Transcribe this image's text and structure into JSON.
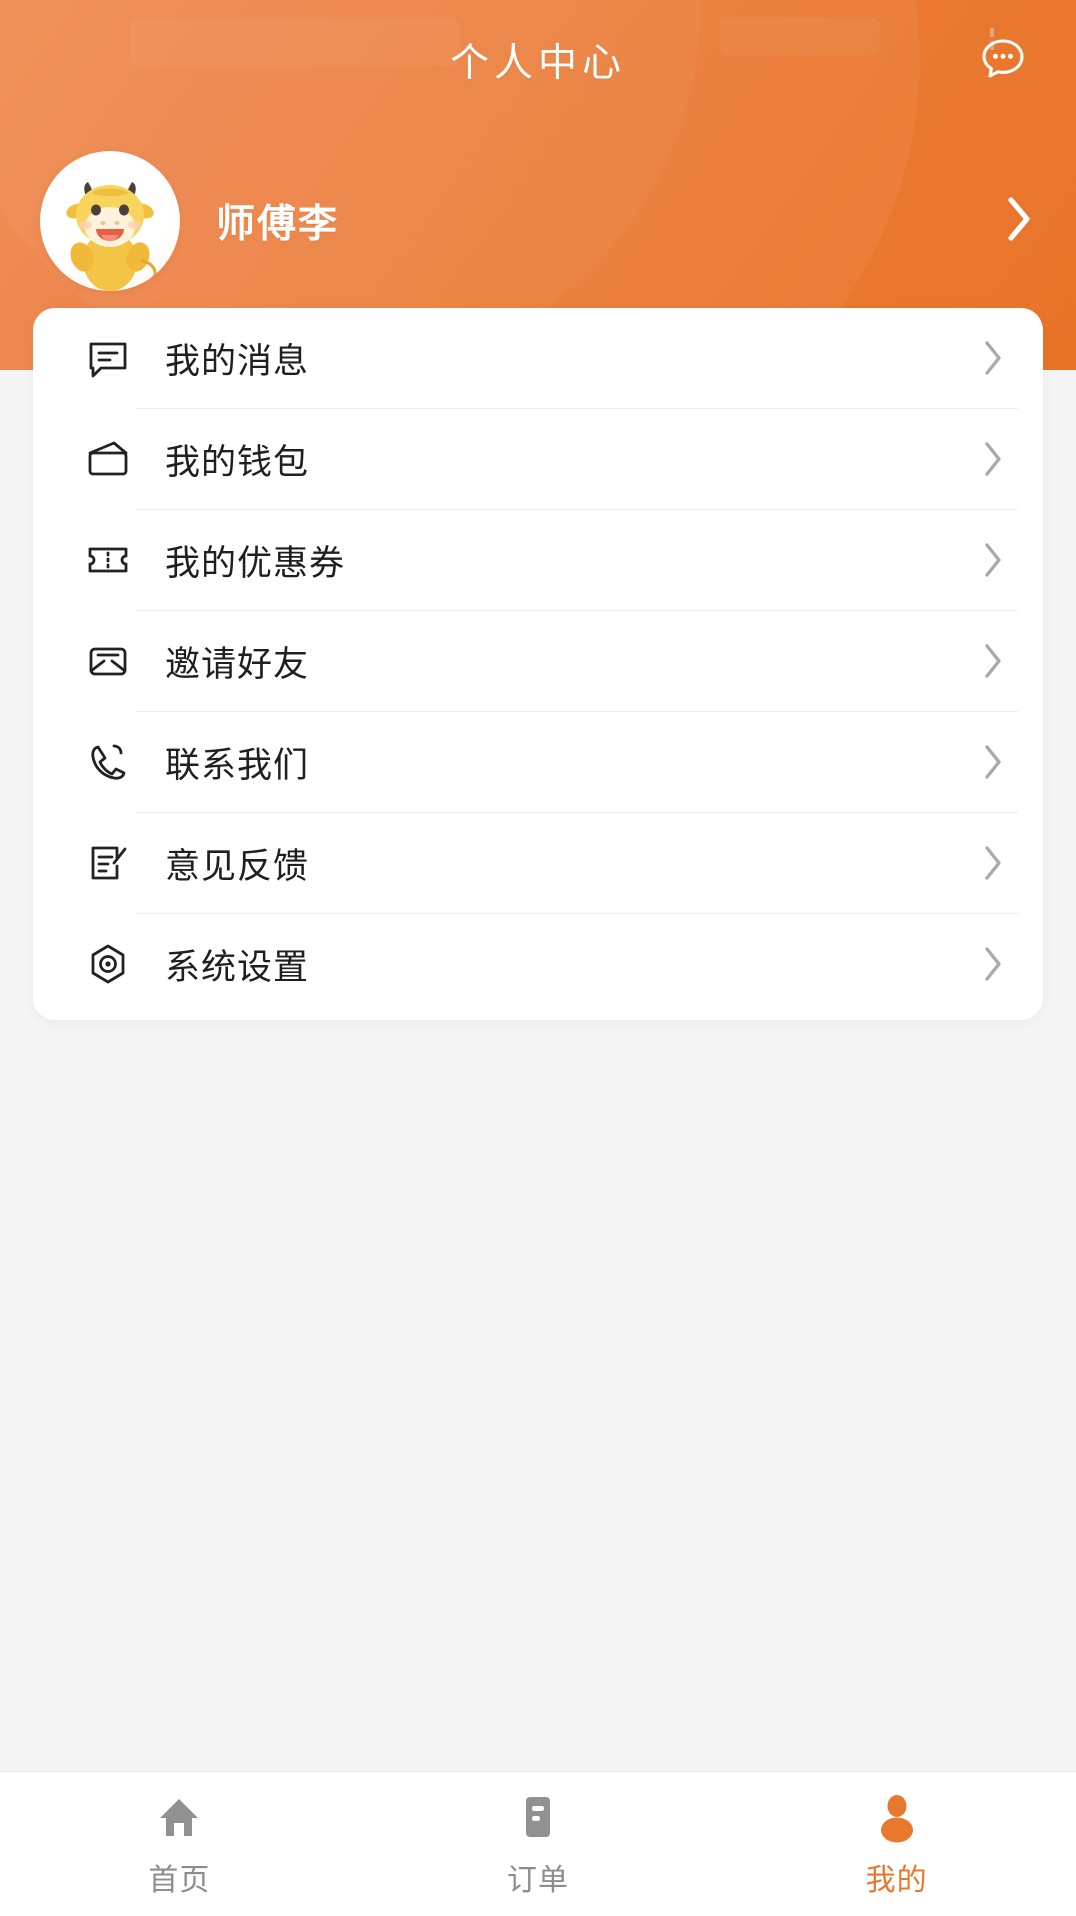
{
  "header": {
    "title": "个人中心",
    "message_icon": "chat-bubble-dots-icon",
    "accent_color": "#e8782e",
    "gradient_from": "#f0894a",
    "gradient_to": "#e87429"
  },
  "profile": {
    "user_name": "师傅李",
    "avatar_icon": "cow-mascot-avatar",
    "arrow_icon": "chevron-right-icon"
  },
  "menu": {
    "items": [
      {
        "label": "我的消息",
        "icon": "message-icon",
        "arrow": "chevron-right-icon"
      },
      {
        "label": "我的钱包",
        "icon": "wallet-icon",
        "arrow": "chevron-right-icon"
      },
      {
        "label": "我的优惠券",
        "icon": "coupon-icon",
        "arrow": "chevron-right-icon"
      },
      {
        "label": "邀请好友",
        "icon": "envelope-icon",
        "arrow": "chevron-right-icon"
      },
      {
        "label": "联系我们",
        "icon": "phone-icon",
        "arrow": "chevron-right-icon"
      },
      {
        "label": "意见反馈",
        "icon": "feedback-edit-icon",
        "arrow": "chevron-right-icon"
      },
      {
        "label": "系统设置",
        "icon": "settings-hex-icon",
        "arrow": "chevron-right-icon"
      }
    ]
  },
  "tabbar": {
    "active_color": "#e8782e",
    "inactive_color": "#8d8d8d",
    "items": [
      {
        "label": "首页",
        "icon": "home-icon",
        "active": false
      },
      {
        "label": "订单",
        "icon": "orders-icon",
        "active": false
      },
      {
        "label": "我的",
        "icon": "profile-person-icon",
        "active": true
      }
    ]
  }
}
